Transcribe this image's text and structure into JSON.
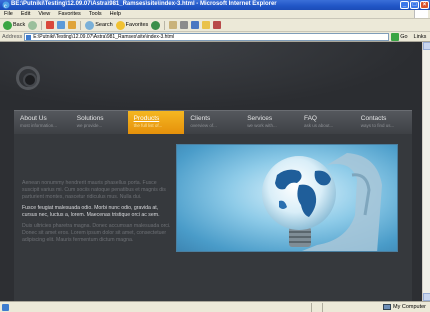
{
  "window": {
    "title": "BE:\\Putniki\\Testing\\12.09.07\\Astra\\981_Ramses\\site\\index-3.html - Microsoft Internet Explorer",
    "controls": [
      "_",
      "□",
      "×"
    ]
  },
  "menu": [
    "File",
    "Edit",
    "View",
    "Favorites",
    "Tools",
    "Help"
  ],
  "toolbar": {
    "back_label": "Back",
    "search_label": "Search",
    "favorites_label": "Favorites"
  },
  "address": {
    "label": "Address",
    "value": "E:\\Putniki\\Testing\\12.09.07\\Astra\\981_Ramses\\site\\index-3.html",
    "go_label": "Go",
    "links_label": "Links"
  },
  "site": {
    "nav": [
      {
        "title": "About Us",
        "sub": "most information..."
      },
      {
        "title": "Solutions",
        "sub": "we provide..."
      },
      {
        "title": "Products",
        "sub": "the full list of..."
      },
      {
        "title": "Clients",
        "sub": "overview of..."
      },
      {
        "title": "Services",
        "sub": "we work with..."
      },
      {
        "title": "FAQ",
        "sub": "ask us about..."
      },
      {
        "title": "Contacts",
        "sub": "ways to find us..."
      }
    ],
    "active_index": 2,
    "paragraphs": [
      "Aenean nonummy hendrerit mauris phasellus porta. Fusce suscipit varius mi. Cum sociis natoque penatibus et magnis dis parturient montes, nascetur ridiculus mus. Nulla dui.",
      "Fusce feugiat malesuada odio. Morbi nunc odio, gravida at, cursus nec, luctus a, lorem. Maecenas tristique orci ac sem.",
      "Duis ultricies pharetra magna. Donec accumsan malesuada orci. Donec sit amet eros. Lorem ipsum dolor sit amet, consectetuer adipiscing elit. Mauris fermentum dictum magna."
    ],
    "accent_color": "#f2a614"
  },
  "status": {
    "zone": "My Computer"
  }
}
